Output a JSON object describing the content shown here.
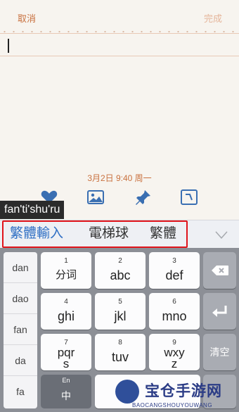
{
  "topbar": {
    "cancel_label": "取消",
    "done_label": "完成"
  },
  "note": {
    "date_text": "3月2日 9:40 周一"
  },
  "toolbar": {
    "icons": [
      "heart-icon",
      "image-icon",
      "pin-icon",
      "clock-icon"
    ]
  },
  "composition": {
    "pinyin": "fan'ti'shu'ru"
  },
  "candidates": {
    "items": [
      "繁體輸入",
      "電梯球",
      "繁體"
    ]
  },
  "pinyin_list": {
    "items": [
      "dan",
      "dao",
      "fan",
      "da",
      "fa"
    ]
  },
  "keys": {
    "k1": {
      "num": "1",
      "label": "分词"
    },
    "k2": {
      "num": "2",
      "label": "abc"
    },
    "k3": {
      "num": "3",
      "label": "def"
    },
    "k4": {
      "num": "4",
      "label": "ghi"
    },
    "k5": {
      "num": "5",
      "label": "jkl"
    },
    "k6": {
      "num": "6",
      "label": "mno"
    },
    "k7": {
      "num": "7",
      "label_top": "pqr",
      "label_bottom": "s"
    },
    "k8": {
      "num": "8",
      "label": "tuv"
    },
    "k9": {
      "num": "9",
      "label_top": "wxy",
      "label_bottom": "z"
    },
    "clear": "清空",
    "lang_small": "En",
    "lang_big": "中"
  },
  "watermark": {
    "title": "宝仓手游网",
    "sub": "BAOCANGSHOUYOUWANG"
  },
  "colors": {
    "accent": "#c9713f",
    "candidate_selected": "#2f6fc4",
    "highlight_box": "#e0141b"
  }
}
